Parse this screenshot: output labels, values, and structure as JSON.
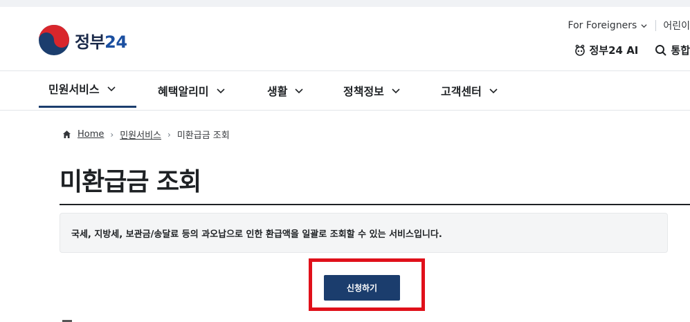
{
  "header": {
    "logo_text": "정부",
    "logo_number": "24",
    "util_top": {
      "foreigners": "For Foreigners",
      "kids": "어린이"
    },
    "util_bottom": {
      "ai": "정부24 AI",
      "search": "통합"
    }
  },
  "gnb": {
    "items": [
      {
        "label": "민원서비스",
        "active": true
      },
      {
        "label": "혜택알리미",
        "active": false
      },
      {
        "label": "생활",
        "active": false
      },
      {
        "label": "정책정보",
        "active": false
      },
      {
        "label": "고객센터",
        "active": false
      }
    ]
  },
  "breadcrumb": {
    "home": "Home",
    "level1": "민원서비스",
    "current": "미환급금 조회"
  },
  "page": {
    "title": "미환급금 조회",
    "notice": "국세, 지방세, 보관금/송달료 등의 과오납으로 인한 환급액을 일괄로 조회할 수 있는 서비스입니다.",
    "apply_button": "신청하기"
  },
  "colors": {
    "primary": "#1b3d6d",
    "highlight": "#e0101a",
    "notice_bg": "#f4f5f6"
  },
  "icons": [
    "taegeuk-logo",
    "chevron-down-icon",
    "ai-robot-icon",
    "search-icon",
    "home-icon",
    "chevron-right-icon"
  ]
}
